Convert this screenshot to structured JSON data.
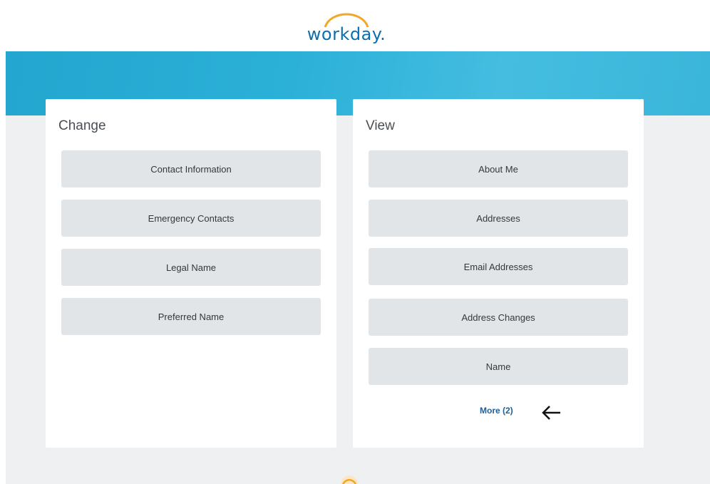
{
  "app": {
    "logo_text": "workday."
  },
  "change_card": {
    "title": "Change",
    "items": [
      {
        "label": "Contact Information"
      },
      {
        "label": "Emergency Contacts"
      },
      {
        "label": "Legal Name"
      },
      {
        "label": "Preferred Name"
      }
    ]
  },
  "view_card": {
    "title": "View",
    "items": [
      {
        "label": "About Me"
      },
      {
        "label": "Addresses"
      },
      {
        "label": "Email Addresses"
      },
      {
        "label": "Address Changes"
      },
      {
        "label": "Name"
      }
    ],
    "more_label": "More (2)"
  },
  "icons": {
    "logo_arc": "sun-arc-icon",
    "annotation_arrow": "arrow-left-icon",
    "footer_logo": "workday-mark-icon"
  },
  "colors": {
    "banner": "#2bb0d8",
    "logo_arc": "#f5a623",
    "logo_text": "#0b6fb0",
    "tile_bg": "#e2e5e8",
    "link": "#1f5f95",
    "canvas_bg": "#eef0f2"
  }
}
